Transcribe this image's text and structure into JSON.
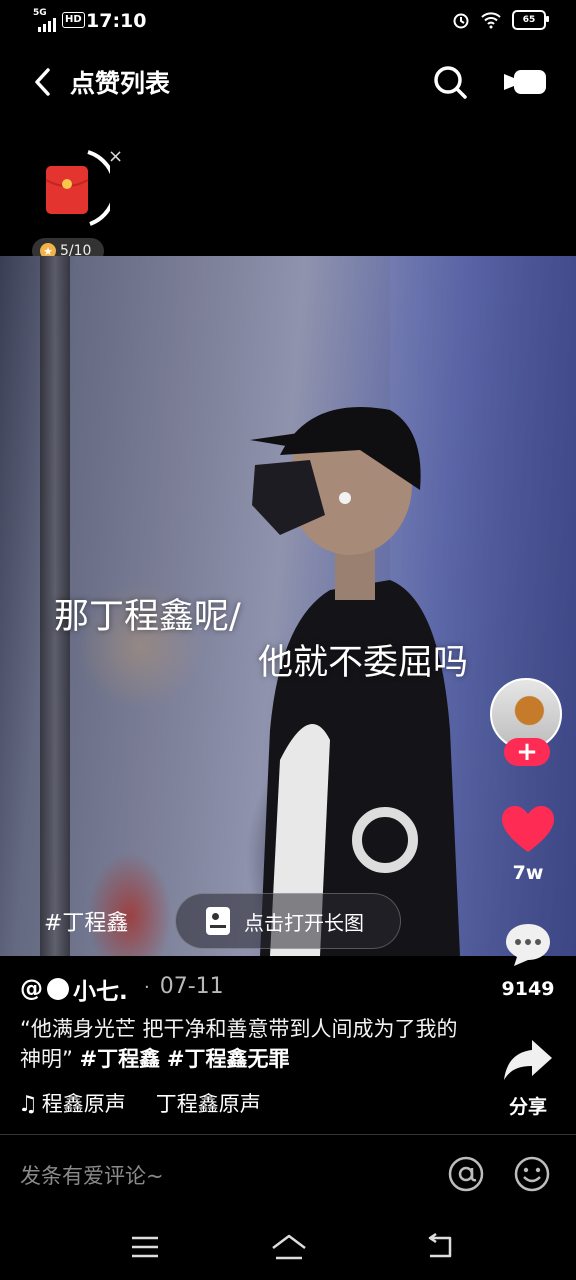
{
  "status_bar": {
    "network": "5G",
    "hd": "HD",
    "time": "17:10",
    "battery": "65",
    "icons": [
      "signal-icon",
      "alarm-icon",
      "wifi-icon",
      "battery-icon"
    ]
  },
  "header": {
    "title": "点赞列表",
    "icons": [
      "back-arrow-icon",
      "search-icon",
      "camera-icon"
    ]
  },
  "red_packet": {
    "progress": "5/10",
    "close": "×"
  },
  "video": {
    "overlay_line1": "那丁程鑫呢/",
    "overlay_line2": "他就不委屈吗",
    "hashtag": "#丁程鑫",
    "long_image_button": "点击打开长图"
  },
  "actions": {
    "follow": "+",
    "likes": "7w",
    "comments": "9149",
    "share": "分享"
  },
  "post": {
    "author": "小七.",
    "author_prefix": "@",
    "date_sep": "·",
    "date": "07-11",
    "description_text": "“他满身光芒 把干净和善意带到人间成为了我的神明”",
    "tag1": "#丁程鑫",
    "tag2": "#丁程鑫无罪",
    "music1": "程鑫原声",
    "music2": "丁程鑫原声"
  },
  "comment_bar": {
    "placeholder": "发条有爱评论~"
  },
  "colors": {
    "accent": "#fe2c55",
    "background": "#000000"
  }
}
